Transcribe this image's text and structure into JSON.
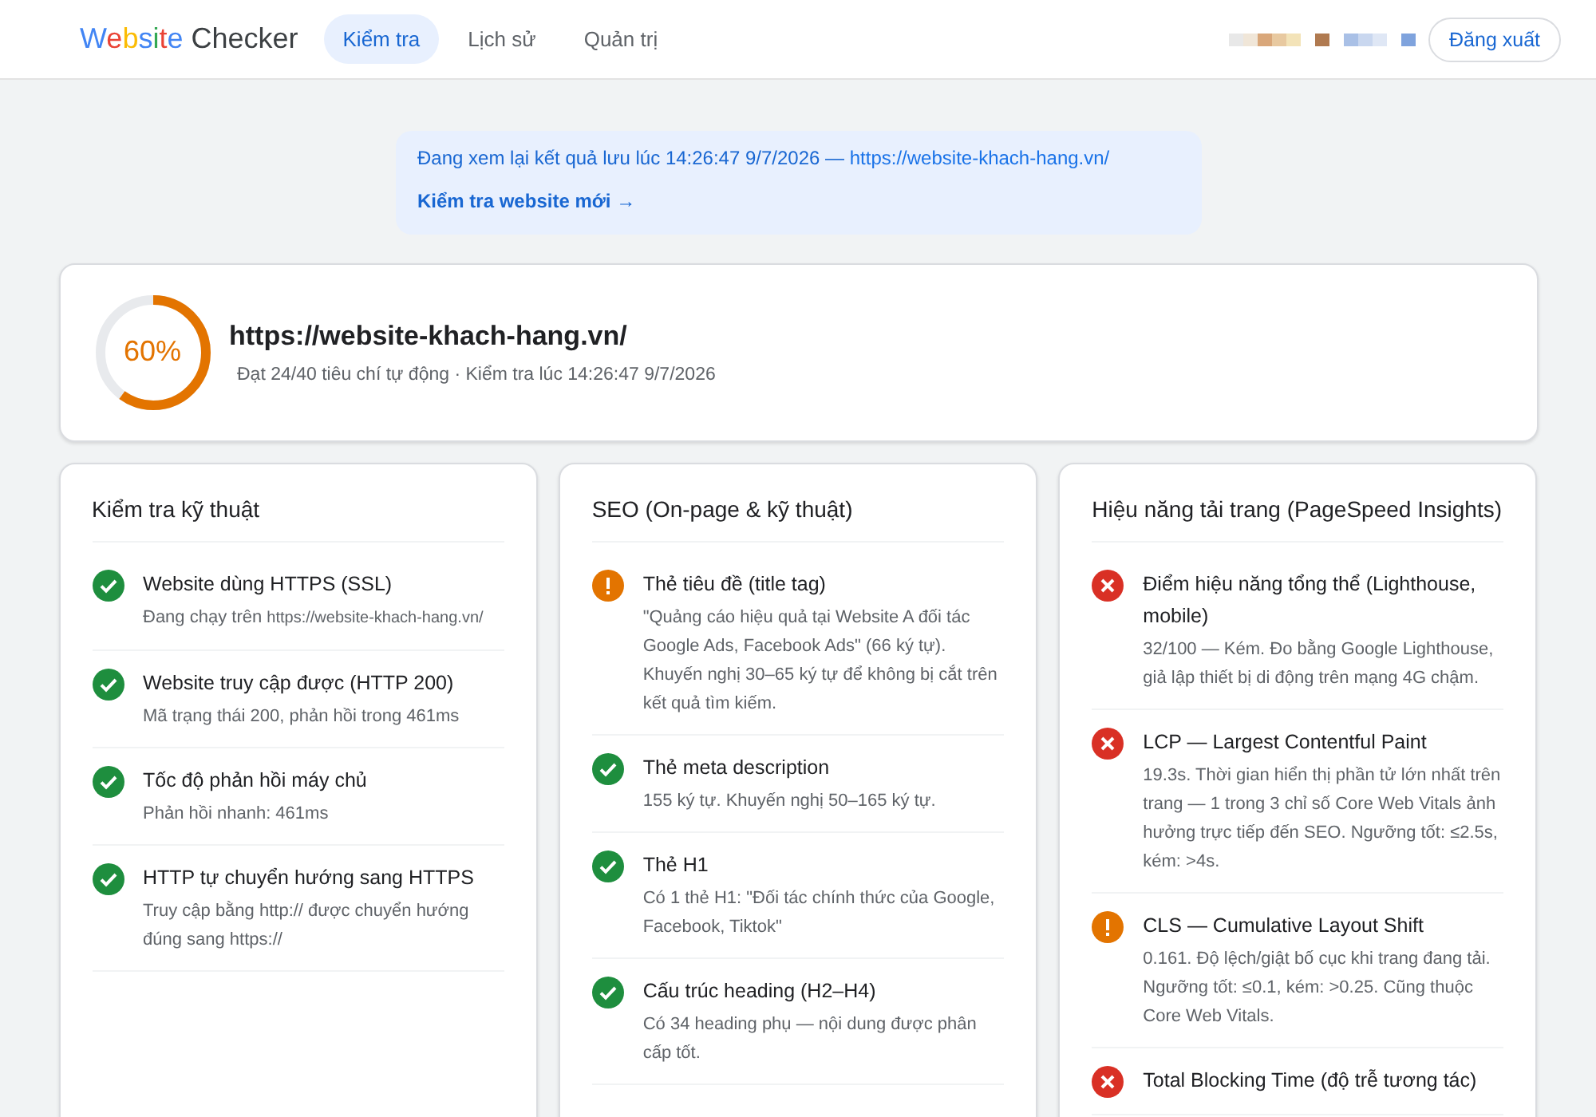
{
  "header": {
    "logo": "Website Checker",
    "nav": [
      {
        "label": "Kiểm tra",
        "selected": true
      },
      {
        "label": "Lịch sử",
        "selected": false
      },
      {
        "label": "Quản trị",
        "selected": false
      }
    ],
    "logout": "Đăng xuất"
  },
  "banner": {
    "text": "Đang xem lại kết quả lưu lúc 14:26:47 9/7/2026 — ",
    "link": "https://website-khach-hang.vn/",
    "action": "Kiểm tra website mới →"
  },
  "summary": {
    "score": "60%",
    "level": 0.6,
    "url": "https://website-khach-hang.vn/",
    "meta": "Đạt 24/40 tiêu chí tự động · Kiểm tra lúc 14:26:47 9/7/2026"
  },
  "sections": [
    {
      "title": "Kiểm tra kỹ thuật",
      "items": [
        {
          "kind": "pass",
          "title": "Website dùng HTTPS (SSL)",
          "desc": "Đang chạy trên ",
          "code": "https://website-khach-hang.vn/"
        },
        {
          "kind": "pass",
          "title": "Website truy cập được (HTTP 200)",
          "desc": "Mã trạng thái 200, phản hồi trong 461ms"
        },
        {
          "kind": "pass",
          "title": "Tốc độ phản hồi máy chủ",
          "desc": "Phản hồi nhanh: 461ms"
        },
        {
          "kind": "pass",
          "title": "HTTP tự chuyển hướng sang HTTPS",
          "desc": "Truy cập bằng http:// được chuyển hướng đúng sang https://"
        }
      ]
    },
    {
      "title": "SEO (On-page & kỹ thuật)",
      "items": [
        {
          "kind": "warn",
          "title": "Thẻ tiêu đề (title tag)",
          "desc": "\"Quảng cáo hiệu quả tại Website A     đối tác Google Ads, Facebook Ads\" (66 ký tự). Khuyến nghị 30–65 ký tự để không bị cắt trên kết quả tìm kiếm."
        },
        {
          "kind": "pass",
          "title": "Thẻ meta description",
          "desc": "155 ký tự. Khuyến nghị 50–165 ký tự."
        },
        {
          "kind": "pass",
          "title": "Thẻ H1",
          "desc": "Có 1 thẻ H1: \"Đối tác chính thức của Google, Facebook, Tiktok\""
        },
        {
          "kind": "pass",
          "title": "Cấu trúc heading (H2–H4)",
          "desc": "Có 34 heading phụ — nội dung được phân cấp tốt."
        }
      ]
    },
    {
      "title": "Hiệu năng tải trang (PageSpeed Insights)",
      "items": [
        {
          "kind": "fail",
          "title": "Điểm hiệu năng tổng thể (Lighthouse, mobile)",
          "desc": "32/100 — Kém. Đo bằng Google Lighthouse, giả lập thiết bị di động trên mạng 4G chậm."
        },
        {
          "kind": "fail",
          "title": "LCP — Largest Contentful Paint",
          "desc": "19.3s. Thời gian hiển thị phần tử lớn nhất trên trang — 1 trong 3 chỉ số Core Web Vitals ảnh hưởng trực tiếp đến SEO. Ngưỡng tốt: ≤2.5s, kém: >4s."
        },
        {
          "kind": "warn",
          "title": "CLS — Cumulative Layout Shift",
          "desc": "0.161. Độ lệch/giật bố cục khi trang đang tải. Ngưỡng tốt: ≤0.1, kém: >0.25. Cũng thuộc Core Web Vitals."
        },
        {
          "kind": "fail",
          "title": "Total Blocking Time (độ trễ tương tác)"
        }
      ]
    }
  ]
}
